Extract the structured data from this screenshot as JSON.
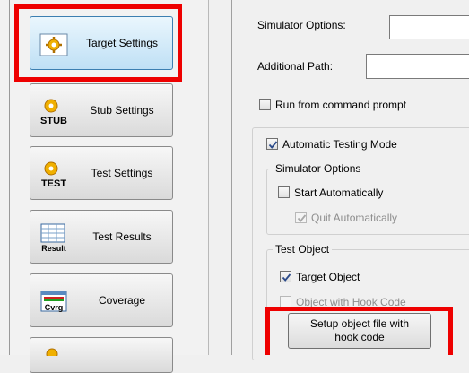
{
  "nav": {
    "target_settings": "Target Settings",
    "stub_settings": "Stub Settings",
    "test_settings": "Test Settings",
    "test_results": "Test Results",
    "coverage": "Coverage",
    "stub_icon_text": "STUB",
    "test_icon_text": "TEST",
    "result_icon_text": "Result",
    "coverage_icon_text": "Cvrg"
  },
  "settings": {
    "simulator_options_label": "Simulator Options:",
    "additional_path_label": "Additional Path:",
    "run_from_command_prompt": "Run from command prompt",
    "automatic_testing_mode": "Automatic Testing Mode",
    "simulator_options_group": "Simulator Options",
    "start_automatically": "Start Automatically",
    "quit_automatically": "Quit Automatically",
    "test_object_group": "Test Object",
    "target_object": "Target Object",
    "object_with_hook_code": "Object with Hook Code",
    "setup_button_line1": "Setup object file with",
    "setup_button_line2": "hook code"
  },
  "states": {
    "run_from_command_prompt_checked": false,
    "automatic_testing_mode_checked": true,
    "start_automatically_checked": false,
    "quit_automatically_checked": true,
    "target_object_checked": true,
    "object_with_hook_code_checked": false
  },
  "colors": {
    "highlight": "#ee0000",
    "active_button": "#bfe0f5"
  }
}
